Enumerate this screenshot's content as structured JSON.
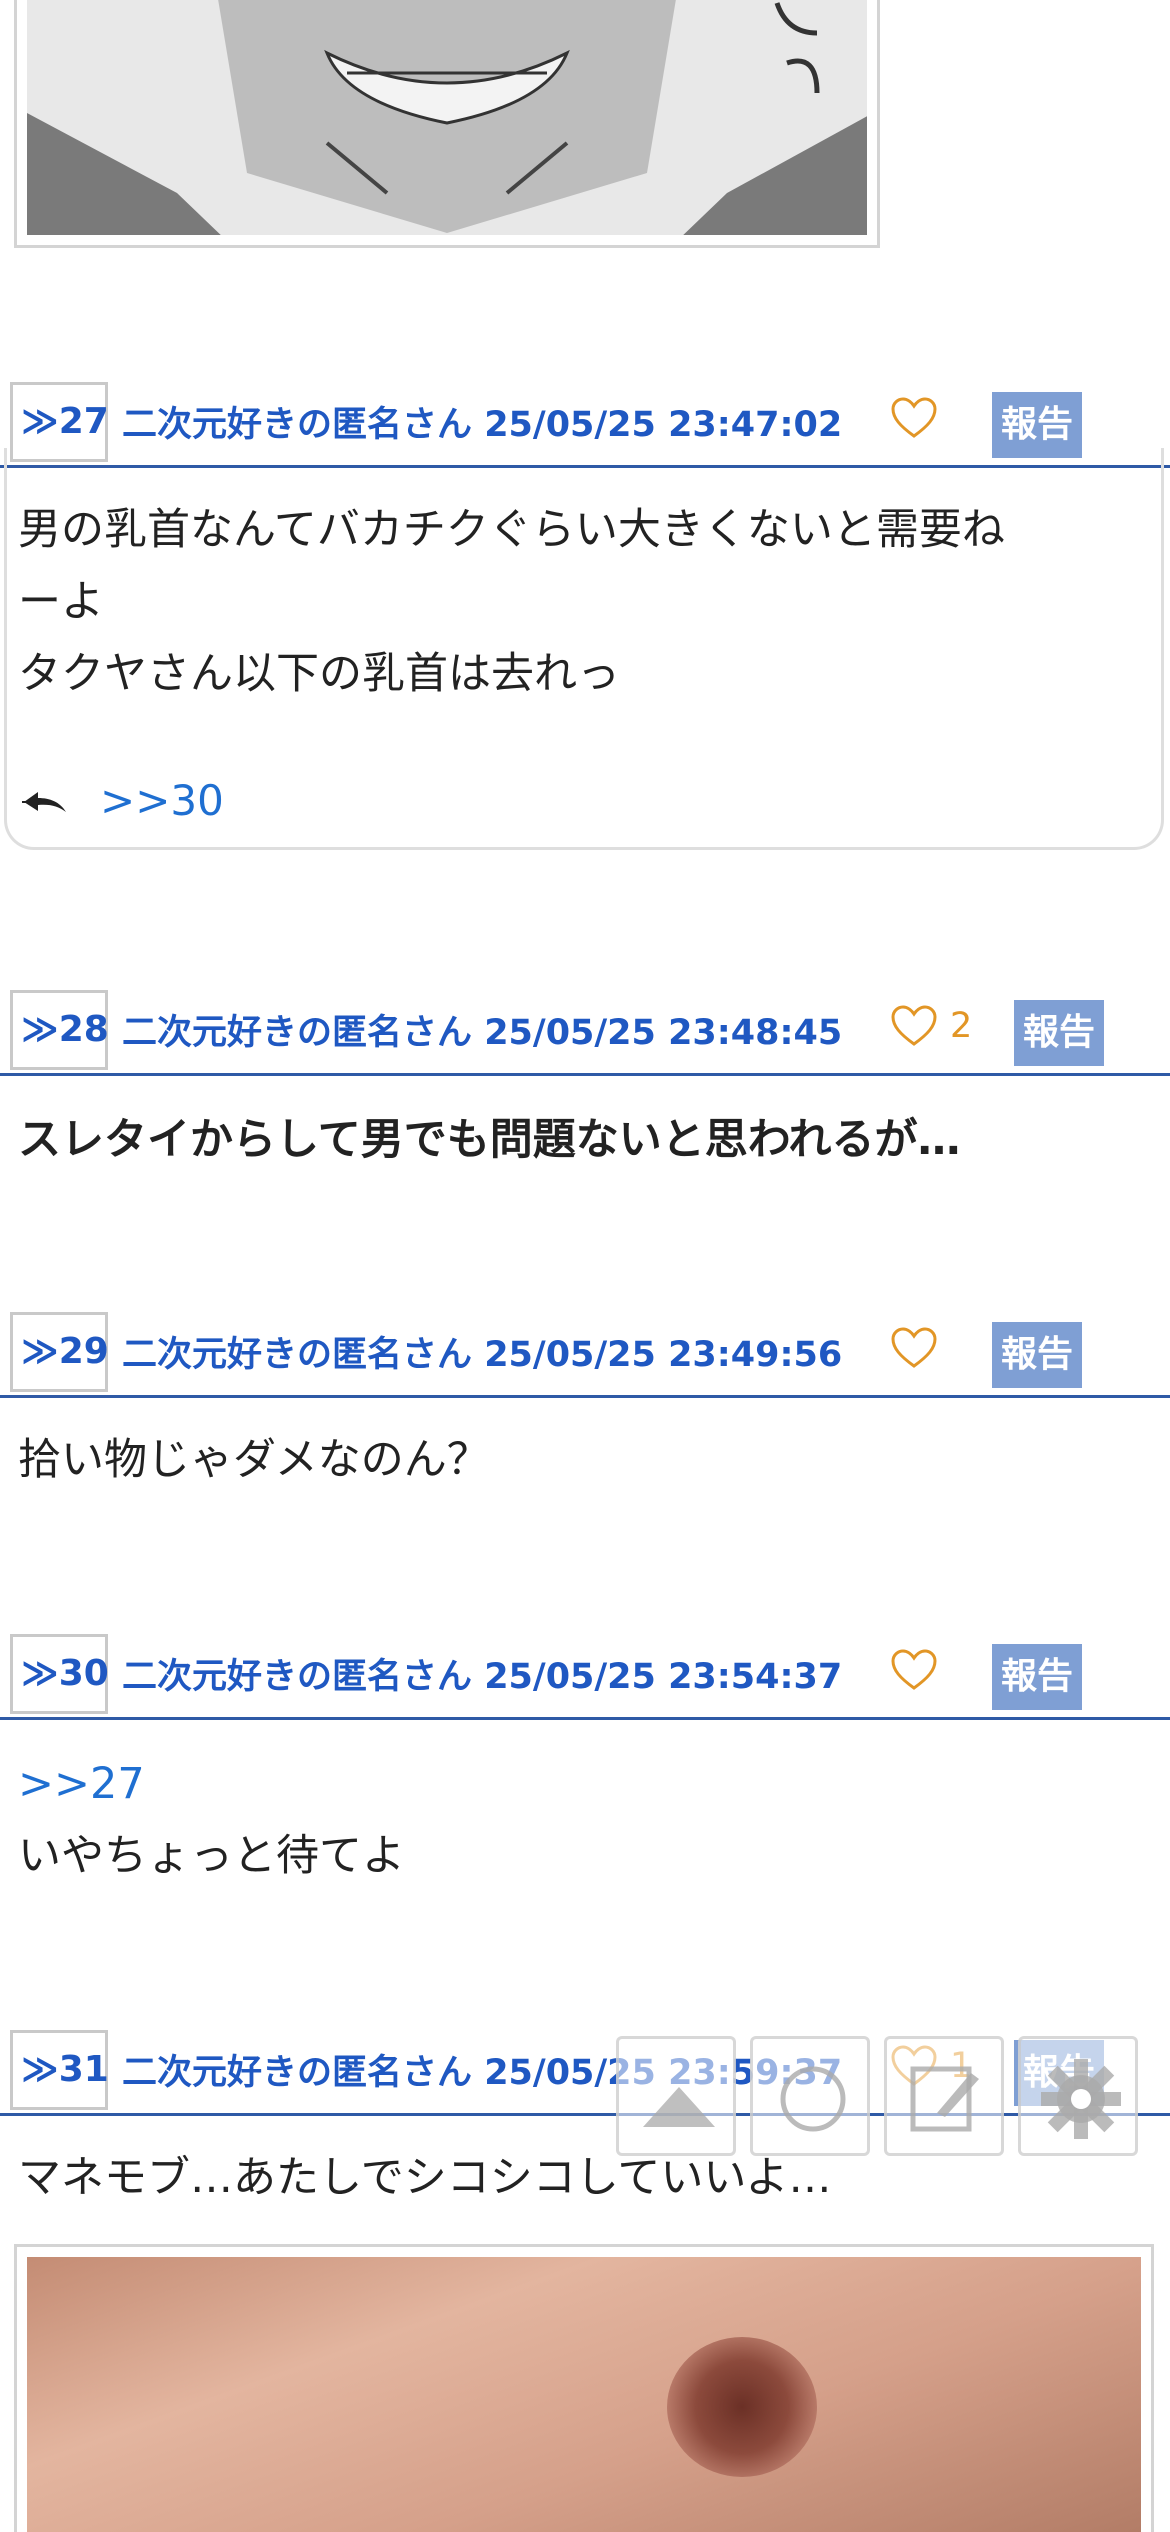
{
  "posts": [
    {
      "number": "≫27",
      "poster": "二次元好きの匿名さん",
      "datetime": "25/05/25 23:47:02",
      "likes": "",
      "report_label": "報告",
      "lines": [
        "男の乳首なんてバカチクぐらい大きくないと需要ね",
        "ーよ",
        "タクヤさん以下の乳首は去れっ"
      ],
      "reply_link": ">>30"
    },
    {
      "number": "≫28",
      "poster": "二次元好きの匿名さん",
      "datetime": "25/05/25 23:48:45",
      "likes": "2",
      "report_label": "報告",
      "lines": [
        "スレタイからして男でも問題ないと思われるが…"
      ]
    },
    {
      "number": "≫29",
      "poster": "二次元好きの匿名さん",
      "datetime": "25/05/25 23:49:56",
      "likes": "",
      "report_label": "報告",
      "lines": [
        "拾い物じゃダメなのん？"
      ]
    },
    {
      "number": "≫30",
      "poster": "二次元好きの匿名さん",
      "datetime": "25/05/25 23:54:37",
      "likes": "",
      "report_label": "報告",
      "quote": ">>27",
      "lines": [
        "いやちょっと待てよ"
      ]
    },
    {
      "number": "≫31",
      "poster": "二次元好きの匿名さん",
      "datetime": "25/05/25 23:59:37",
      "likes": "1",
      "report_label": "報告",
      "lines": [
        "マネモブ…あたしでシコシコしていいよ…"
      ]
    }
  ],
  "icons": {
    "heart": "heart-outline-icon",
    "reply": "reply-icon",
    "scroll_top": "up-arrow-icon",
    "refresh": "circle-icon",
    "write": "pencil-icon",
    "settings": "gear-icon"
  },
  "colors": {
    "link_blue": "#1f58c2",
    "report_bg": "#7f9fd4",
    "heart_orange": "#e29626",
    "divider": "#2f5aa6"
  }
}
